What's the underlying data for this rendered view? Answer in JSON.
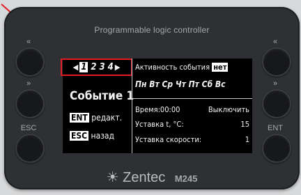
{
  "device": {
    "title": "Programmable logic controller",
    "brand": "Zentec",
    "model": "M245"
  },
  "buttons": {
    "left": [
      {
        "label": "«"
      },
      {
        "label": "»"
      },
      {
        "label": "ESC"
      }
    ],
    "right": [
      {
        "label": "«"
      },
      {
        "label": "»"
      },
      {
        "label": "ENT"
      }
    ]
  },
  "screen": {
    "tabs": {
      "prev": "◀",
      "items": [
        "1",
        "2",
        "3",
        "4"
      ],
      "next": "▶"
    },
    "event_title": "Событие 1",
    "ent_key": "ENT",
    "ent_text": "редакт.",
    "esc_key": "ESC",
    "esc_text": "назад",
    "activity_label": "Активность события",
    "activity_value": "нет",
    "days": "Пн Вт Ср Чт Пт Сб Вс",
    "time_label": "Время:00:00",
    "time_action": "Выключить",
    "setpoint_t_label": "Уставка t, °C:",
    "setpoint_t_value": "15",
    "setpoint_speed_label": "Уставка скорости:",
    "setpoint_speed_value": "1"
  },
  "colors": {
    "highlight": "#e21b25",
    "device_body": "#2e3033"
  }
}
